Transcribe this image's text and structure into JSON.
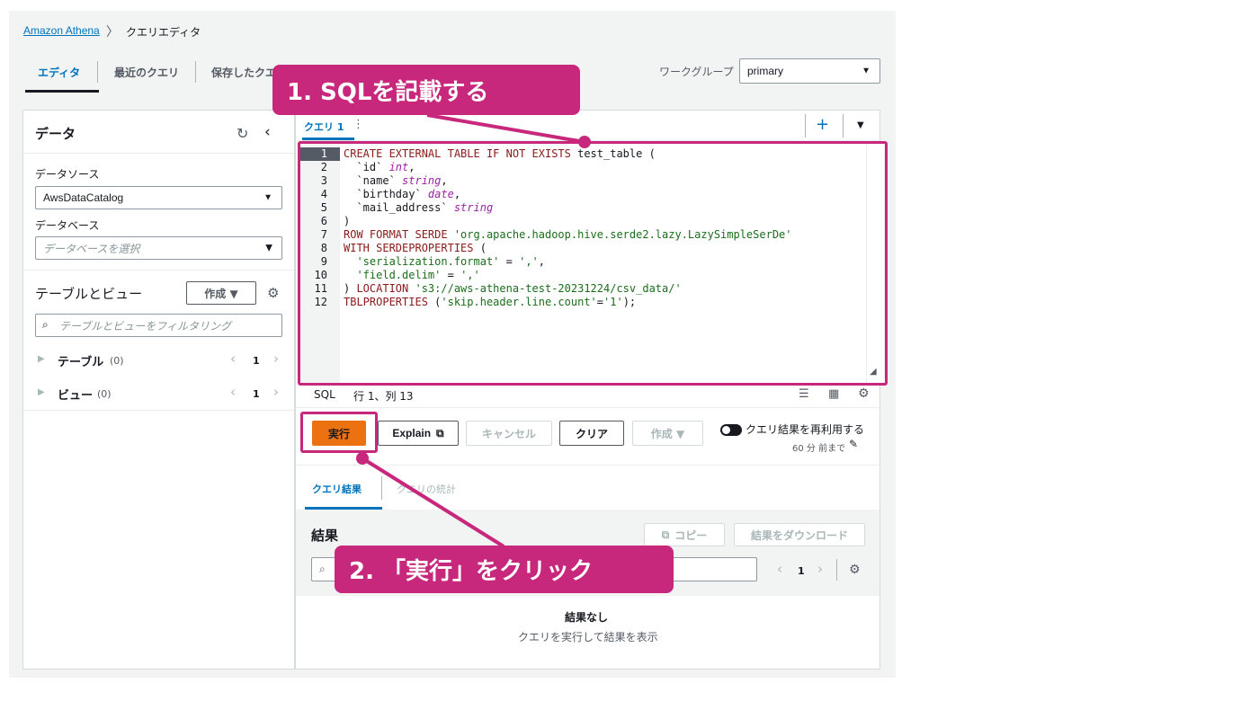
{
  "breadcrumb": {
    "root": "Amazon Athena",
    "separator": "〉",
    "current": "クエリエディタ"
  },
  "top_tabs": [
    {
      "label": "エディタ"
    },
    {
      "label": "最近のクエリ"
    },
    {
      "label": "保存したクエリ"
    }
  ],
  "workgroup": {
    "label": "ワークグループ",
    "value": "primary"
  },
  "data_panel": {
    "title": "データ",
    "datasource_label": "データソース",
    "datasource_value": "AwsDataCatalog",
    "database_label": "データベース",
    "database_placeholder": "データベースを選択",
    "tables_views_title": "テーブルとビュー",
    "create_label": "作成 ▼",
    "filter_placeholder": "テーブルとビューをフィルタリング",
    "tables_label": "テーブル",
    "tables_count": "(0)",
    "views_label": "ビュー",
    "views_count": "(0)",
    "page": "1"
  },
  "editor": {
    "tab_label": "クエリ 1",
    "line_numbers": [
      "1",
      "2",
      "3",
      "4",
      "5",
      "6",
      "7",
      "8",
      "9",
      "10",
      "11",
      "12"
    ],
    "status_lang": "SQL",
    "status_pos": "行 1、列 13"
  },
  "sql": {
    "l1a": "CREATE EXTERNAL TABLE IF NOT EXISTS ",
    "l1b": "test_table (",
    "l2a": "  `id` ",
    "l2b": "int",
    "l2c": ",",
    "l3a": "  `name` ",
    "l3b": "string",
    "l3c": ",",
    "l4a": "  `birthday` ",
    "l4b": "date",
    "l4c": ",",
    "l5a": "  `mail_address` ",
    "l5b": "string",
    "l6": ")",
    "l7a": "ROW FORMAT SERDE ",
    "l7b": "'org.apache.hadoop.hive.serde2.lazy.LazySimpleSerDe'",
    "l8a": "WITH SERDEPROPERTIES",
    "l8b": " (",
    "l9a": "  ",
    "l9b": "'serialization.format'",
    "l9c": " = ",
    "l9d": "','",
    "l9e": ",",
    "l10a": "  ",
    "l10b": "'field.delim'",
    "l10c": " = ",
    "l10d": "','",
    "l11a": ") ",
    "l11b": "LOCATION",
    "l11c": " ",
    "l11d": "'s3://aws-athena-test-20231224/csv_data/'",
    "l12a": "TBLPROPERTIES",
    "l12b": " (",
    "l12c": "'skip.header.line.count'",
    "l12d": "=",
    "l12e": "'1'",
    "l12f": ");"
  },
  "actions": {
    "run": "実行",
    "explain": "Explain",
    "cancel": "キャンセル",
    "clear": "クリア",
    "create": "作成 ▼",
    "reuse_label": "クエリ結果を再利用する",
    "reuse_sub": "60 分 前まで"
  },
  "results": {
    "tab_results": "クエリ結果",
    "tab_stats": "クエリの統計",
    "title": "結果",
    "copy": "コピー",
    "download": "結果をダウンロード",
    "page": "1",
    "empty_title": "結果なし",
    "empty_sub": "クエリを実行して結果を表示"
  },
  "callouts": {
    "step1": "1. SQLを記載する",
    "step2": "2. 「実行」をクリック"
  },
  "colors": {
    "accent": "#c7287c",
    "run_button": "#ec7211",
    "link": "#0073bb"
  }
}
